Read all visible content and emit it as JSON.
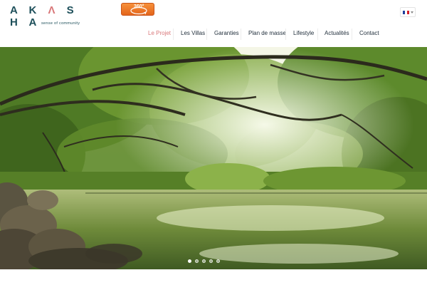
{
  "brand": {
    "logo_text": "AKASHA",
    "tagline": "sense of community",
    "color": "#1d4f5a",
    "accent": "#d9787a"
  },
  "header": {
    "tour_button_label": "360°",
    "language": {
      "selected": "FR",
      "icon": "france-flag-icon"
    }
  },
  "nav": {
    "items": [
      {
        "label": "Le Projet",
        "active": true
      },
      {
        "label": "Les Villas",
        "active": false
      },
      {
        "label": "Garanties",
        "active": false
      },
      {
        "label": "Plan de masse",
        "active": false
      },
      {
        "label": "Lifestyle",
        "active": false
      },
      {
        "label": "Actualités",
        "active": false
      },
      {
        "label": "Contact",
        "active": false
      }
    ]
  },
  "hero": {
    "image_subject": "tropical forest canopy over a calm river",
    "slides_count": 5,
    "active_slide": 1
  }
}
